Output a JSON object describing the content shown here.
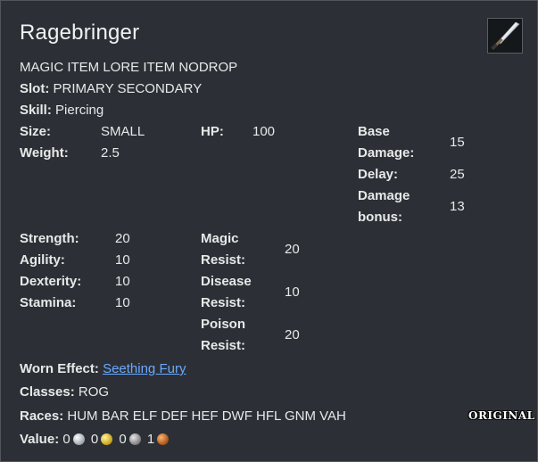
{
  "item": {
    "name": "Ragebringer",
    "icon": "sword-icon",
    "flags": "MAGIC ITEM LORE ITEM NODROP",
    "slot_label": "Slot:",
    "slot_value": "PRIMARY SECONDARY",
    "skill_label": "Skill:",
    "skill_value": "Piercing"
  },
  "stats": {
    "size_label": "Size:",
    "size_value": "SMALL",
    "weight_label": "Weight:",
    "weight_value": "2.5",
    "hp_label": "HP:",
    "hp_value": "100",
    "base_damage_label_1": "Base",
    "base_damage_label_2": "Damage:",
    "base_damage_value": "15",
    "delay_label": "Delay:",
    "delay_value": "25",
    "damage_bonus_label_1": "Damage",
    "damage_bonus_label_2": "bonus:",
    "damage_bonus_value": "13"
  },
  "attributes": {
    "strength_label": "Strength:",
    "strength_value": "20",
    "agility_label": "Agility:",
    "agility_value": "10",
    "dexterity_label": "Dexterity:",
    "dexterity_value": "10",
    "stamina_label": "Stamina:",
    "stamina_value": "10",
    "magic_resist_label_1": "Magic",
    "magic_resist_label_2": "Resist:",
    "magic_resist_value": "20",
    "disease_resist_label_1": "Disease",
    "disease_resist_label_2": "Resist:",
    "disease_resist_value": "10",
    "poison_resist_label_1": "Poison",
    "poison_resist_label_2": "Resist:",
    "poison_resist_value": "20"
  },
  "effects": {
    "worn_label": "Worn Effect:",
    "worn_value": "Seething Fury",
    "classes_label": "Classes:",
    "classes_value": "ROG",
    "races_label": "Races:",
    "races_value": "HUM BAR ELF DEF HEF DWF HFL GNM VAH"
  },
  "value": {
    "label": "Value:",
    "platinum": "0",
    "gold": "0",
    "silver": "0",
    "copper": "1"
  },
  "badge": "ORIGINAL"
}
